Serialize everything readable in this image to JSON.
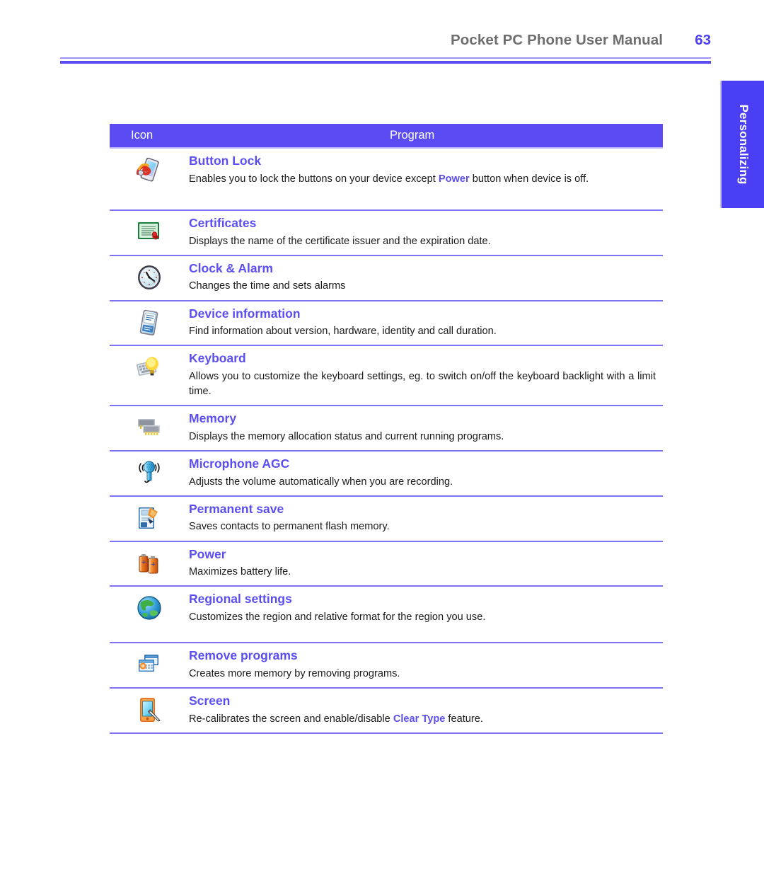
{
  "header": {
    "title": "Pocket PC Phone User Manual",
    "page_number": "63",
    "rule_color": "#5a4bf2"
  },
  "side_tab": {
    "label": "Personalizing",
    "background": "#4b3ff5",
    "text_color": "#ffffff"
  },
  "table": {
    "columns": {
      "icon": "Icon",
      "program": "Program"
    },
    "header_background": "#5a4bf2",
    "title_color": "#5b4ef0",
    "rows": [
      {
        "icon": "button-lock-icon",
        "title": "Button Lock",
        "desc_before": "Enables you to lock the buttons on your device except ",
        "desc_highlight": "Power",
        "desc_after": " button when device is off."
      },
      {
        "icon": "certificates-icon",
        "title": "Certificates",
        "desc_before": "Displays the name of the certificate issuer and the expiration date.",
        "desc_highlight": "",
        "desc_after": ""
      },
      {
        "icon": "clock-alarm-icon",
        "title": "Clock & Alarm",
        "desc_before": "Changes the time and sets alarms",
        "desc_highlight": "",
        "desc_after": ""
      },
      {
        "icon": "device-information-icon",
        "title": "Device information",
        "desc_before": "Find information about version, hardware, identity and call duration.",
        "desc_highlight": "",
        "desc_after": ""
      },
      {
        "icon": "keyboard-icon",
        "title": "Keyboard",
        "desc_before": "Allows you to customize the keyboard settings, eg. to switch on/off the keyboard backlight with a limit time.",
        "desc_highlight": "",
        "desc_after": ""
      },
      {
        "icon": "memory-icon",
        "title": "Memory",
        "desc_before": "Displays the memory allocation status and current running programs.",
        "desc_highlight": "",
        "desc_after": ""
      },
      {
        "icon": "microphone-agc-icon",
        "title": "Microphone AGC",
        "desc_before": "Adjusts the volume automatically when you are recording.",
        "desc_highlight": "",
        "desc_after": ""
      },
      {
        "icon": "permanent-save-icon",
        "title": "Permanent save",
        "desc_before": "Saves contacts to permanent flash memory.",
        "desc_highlight": "",
        "desc_after": ""
      },
      {
        "icon": "power-icon",
        "title": "Power",
        "desc_before": "Maximizes battery life.",
        "desc_highlight": "",
        "desc_after": ""
      },
      {
        "icon": "regional-settings-icon",
        "title": "Regional settings",
        "desc_before": "Customizes the region and relative format for the region you use.",
        "desc_highlight": "",
        "desc_after": ""
      },
      {
        "icon": "remove-programs-icon",
        "title": "Remove programs",
        "desc_before": "Creates more memory by removing programs.",
        "desc_highlight": "",
        "desc_after": ""
      },
      {
        "icon": "screen-icon",
        "title": "Screen",
        "desc_before": "Re-calibrates the screen and enable/disable ",
        "desc_highlight": "Clear Type",
        "desc_after": " feature."
      }
    ]
  }
}
